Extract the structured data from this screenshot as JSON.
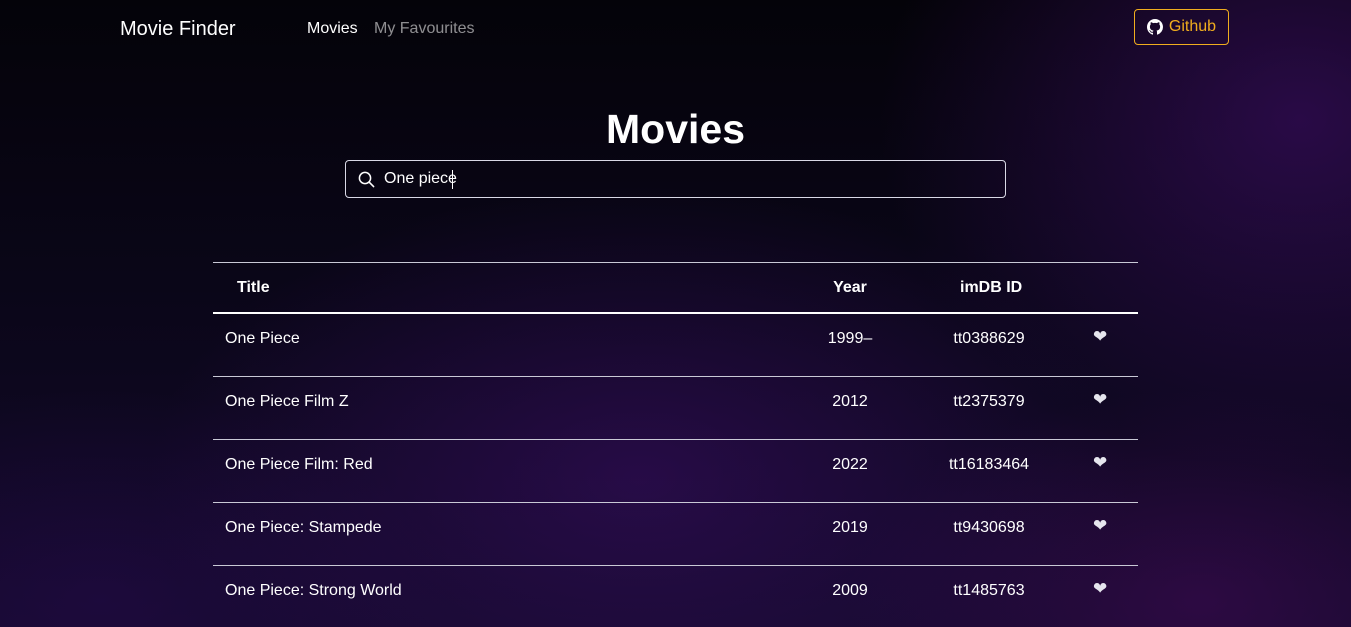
{
  "navbar": {
    "brand": "Movie Finder",
    "links": [
      "Movies",
      "My Favourites"
    ],
    "github_label": "Github",
    "accent_color": "#f0ad1e"
  },
  "page": {
    "title": "Movies"
  },
  "search": {
    "value": "One piece",
    "icon": "search-icon"
  },
  "table": {
    "headers": [
      "Title",
      "Year",
      "imDB ID",
      ""
    ],
    "rows": [
      {
        "title": "One Piece",
        "year": "1999–",
        "imdb": "tt0388629",
        "fav": "❤"
      },
      {
        "title": "One Piece Film Z",
        "year": "2012",
        "imdb": "tt2375379",
        "fav": "❤"
      },
      {
        "title": "One Piece Film: Red",
        "year": "2022",
        "imdb": "tt16183464",
        "fav": "❤"
      },
      {
        "title": "One Piece: Stampede",
        "year": "2019",
        "imdb": "tt9430698",
        "fav": "❤"
      },
      {
        "title": "One Piece: Strong World",
        "year": "2009",
        "imdb": "tt1485763",
        "fav": "❤"
      }
    ]
  }
}
